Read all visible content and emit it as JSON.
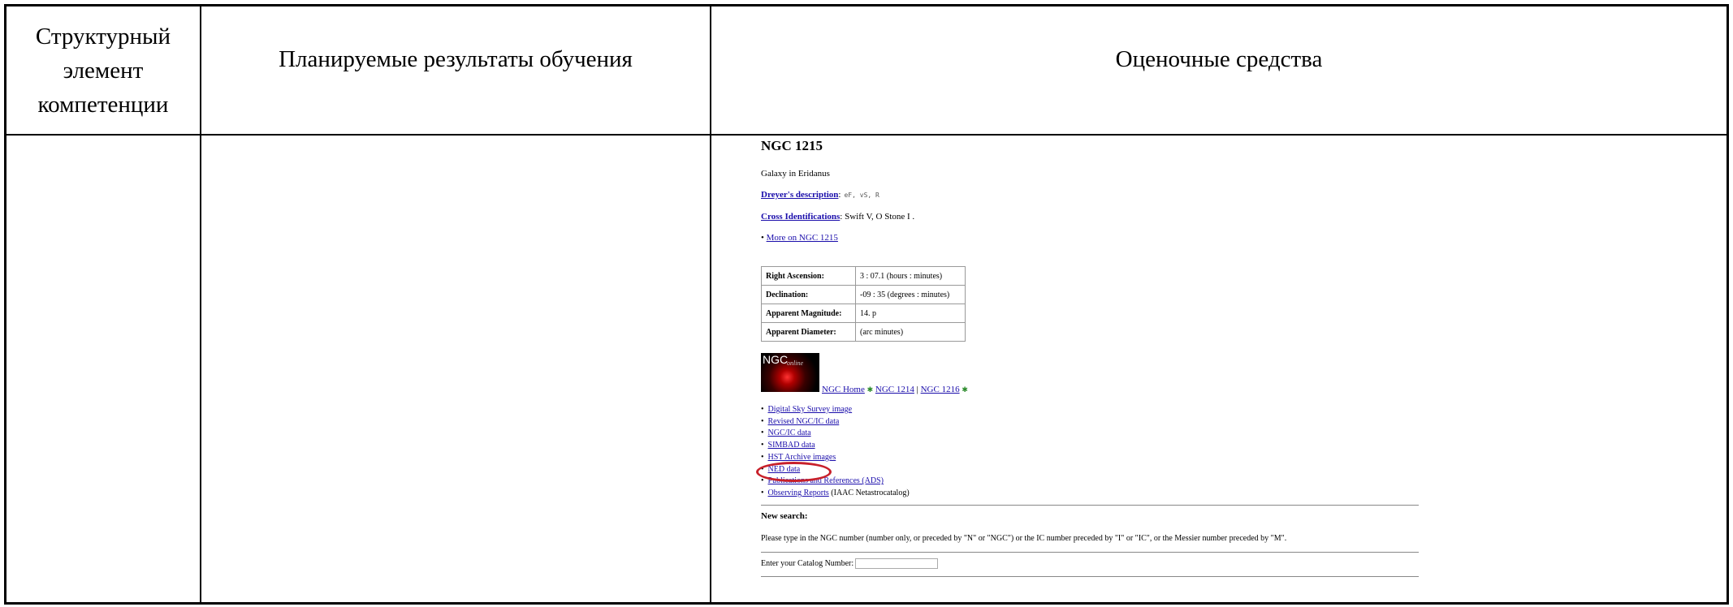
{
  "table": {
    "headers": {
      "col1": [
        "Структурный",
        "элемент",
        "компетенции"
      ],
      "col2": "Планируемые результаты обучения",
      "col3": "Оценочные средства"
    }
  },
  "ngc_page": {
    "title": "NGC 1215",
    "subtitle": "Galaxy in Eridanus",
    "dreyer_label": "Dreyer's description",
    "dreyer_value": "eF, vS, R",
    "cross_label": "Cross Identifications",
    "cross_value": "Swift V, O Stone I .",
    "more_link": "More on NGC 1215",
    "info_rows": [
      {
        "key": "Right Ascension:",
        "value": "3 : 07.1 (hours : minutes)"
      },
      {
        "key": "Declination:",
        "value": "-09 : 35 (degrees : minutes)"
      },
      {
        "key": "Apparent Magnitude:",
        "value": "14. p"
      },
      {
        "key": "Apparent Diameter:",
        "value": "(arc minutes)"
      }
    ],
    "logo_text": "NGC",
    "logo_sub": "online",
    "nav": {
      "home": "NGC Home",
      "prev": "NGC 1214",
      "sep": "|",
      "next": "NGC 1216"
    },
    "links": [
      "Digital Sky Survey image",
      "Revised NGC/IC data",
      "NGC/IC data",
      "SIMBAD data",
      "HST Archive images",
      "NED data",
      "Publications and References (ADS)",
      "Observing Reports"
    ],
    "observing_suffix": "(IAAC Netastrocatalog)",
    "new_search": "New search",
    "search_desc": "Please type in the NGC number (number only, or preceded by \"N\" or \"NGC\") or the IC number preceded by \"I\" or \"IC\", or the Messier number preceded by \"M\".",
    "enter_label": "Enter your Catalog Number:"
  },
  "colors": {
    "link": "#1a0dab",
    "highlight_circle": "#c8202a"
  }
}
